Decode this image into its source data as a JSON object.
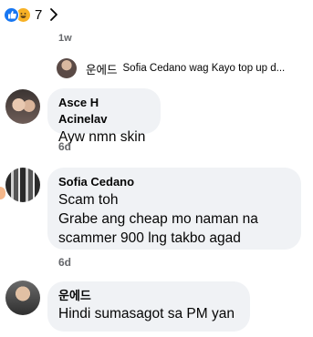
{
  "reactions": {
    "icons": [
      "like-icon",
      "haha-icon"
    ],
    "count": "7",
    "colors": {
      "like": "#1877f2",
      "haha": "#f7b125"
    }
  },
  "stub": {
    "time": "1w"
  },
  "reply_preview": {
    "author": "운에드",
    "text": "Sofia Cedano wag Kayo top up d..."
  },
  "comments": [
    {
      "author": "Asce H Acinelav",
      "text": "Ayw nmn skin",
      "time": "6d"
    },
    {
      "author": "Sofia Cedano",
      "text": "Scam toh\nGrabe ang cheap mo naman na\nscammer 900 lng takbo agad",
      "time": "6d"
    },
    {
      "author": "운에드",
      "text": "Hindi sumasagot sa PM yan"
    }
  ],
  "colors": {
    "bubble_bg": "#f0f2f5",
    "meta_text": "#65676b",
    "text": "#050505"
  }
}
